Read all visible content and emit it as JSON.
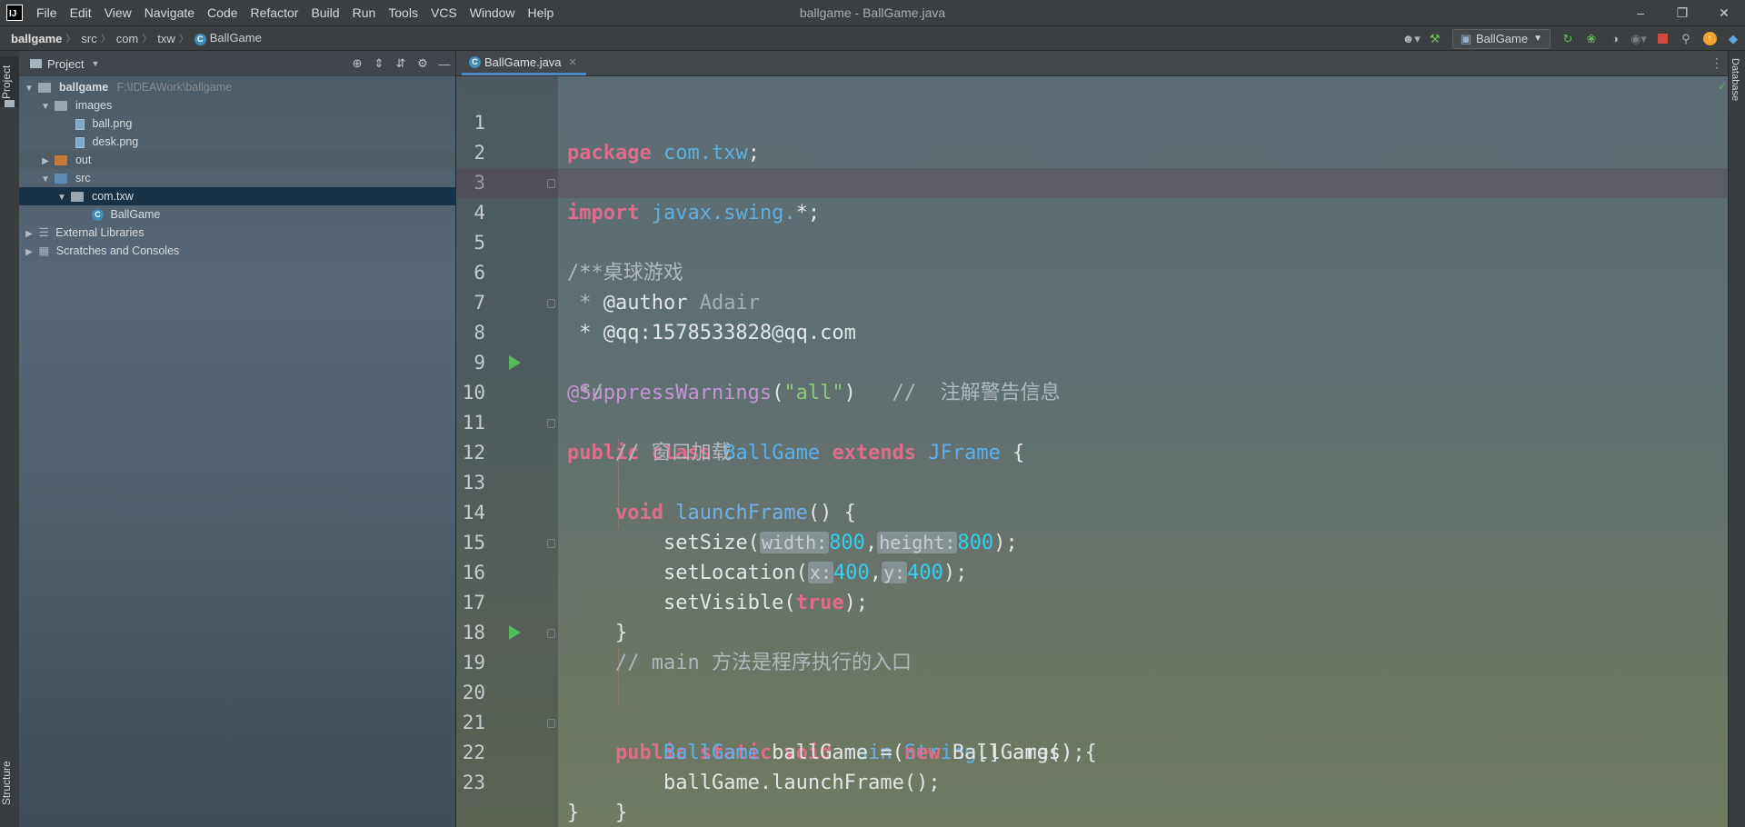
{
  "window": {
    "logo": "IJ",
    "title": "ballgame - BallGame.java",
    "menu": [
      "File",
      "Edit",
      "View",
      "Navigate",
      "Code",
      "Refactor",
      "Build",
      "Run",
      "Tools",
      "VCS",
      "Window",
      "Help"
    ],
    "controls": {
      "minimize": "–",
      "restore": "❐",
      "close": "✕"
    }
  },
  "breadcrumb": [
    "ballgame",
    "src",
    "com",
    "txw",
    "BallGame"
  ],
  "toolbar": {
    "run_config": "BallGame",
    "icons": [
      "user-icon",
      "build-hammer-icon",
      "run-config-icon",
      "rerun-icon",
      "debug-icon",
      "coverage-icon",
      "profile-icon",
      "stop-icon",
      "search-icon",
      "update-icon",
      "plugin-icon"
    ]
  },
  "sidebar": {
    "project_tab": "Project",
    "structure_tab": "Structure",
    "database_tab": "Database"
  },
  "project_panel": {
    "title": "Project",
    "tree": [
      {
        "label": "ballgame",
        "hint": "F:\\IDEAWork\\ballgame",
        "depth": 0,
        "type": "module",
        "expanded": true
      },
      {
        "label": "images",
        "depth": 1,
        "type": "folder",
        "expanded": true
      },
      {
        "label": "ball.png",
        "depth": 2,
        "type": "file"
      },
      {
        "label": "desk.png",
        "depth": 2,
        "type": "file"
      },
      {
        "label": "out",
        "depth": 1,
        "type": "folder-orange",
        "expanded": false
      },
      {
        "label": "src",
        "depth": 1,
        "type": "folder-blue",
        "expanded": true
      },
      {
        "label": "com.txw",
        "depth": 2,
        "type": "package",
        "expanded": true,
        "selected": true
      },
      {
        "label": "BallGame",
        "depth": 3,
        "type": "class"
      },
      {
        "label": "External Libraries",
        "depth": 0,
        "type": "libraries",
        "expanded": false
      },
      {
        "label": "Scratches and Consoles",
        "depth": 0,
        "type": "scratches",
        "expanded": false
      }
    ]
  },
  "editor": {
    "tab": "BallGame.java",
    "line_numbers": [
      "1",
      "2",
      "3",
      "4",
      "5",
      "6",
      "7",
      "8",
      "9",
      "10",
      "11",
      "12",
      "13",
      "14",
      "15",
      "16",
      "17",
      "18",
      "19",
      "20",
      "21",
      "22",
      "23"
    ],
    "code": {
      "l1_kw": "package",
      "l1_pkg": "com.txw",
      "l1_end": ";",
      "l3_kw": "import",
      "l3_pkg": "javax.swing.",
      "l3_end": "*;",
      "l4": "/**",
      "l5": " * 桌球游戏",
      "l6_a": " * ",
      "l6_tag": "@author",
      "l6_val": " Adair",
      "l7": " * @qq:1578533828@qq.com",
      "l8": " */",
      "l9_anno": "@SuppressWarnings",
      "l9_open": "(",
      "l9_str": "\"all\"",
      "l9_close": ")",
      "l9_cm": "   //  注解警告信息",
      "l10_kw1": "public",
      "l10_kw2": "class",
      "l10_cls": "BallGame",
      "l10_kw3": "extends",
      "l10_sup": "JFrame",
      "l10_brace": " {",
      "l11": "    // 窗口加载",
      "l12_kw": "void",
      "l12_fn": "launchFrame",
      "l12_rest": "() {",
      "l13_call": "setSize(",
      "l13_h1": "width:",
      "l13_v1": "800",
      "l13_sep": ",",
      "l13_h2": "height:",
      "l13_v2": "800",
      "l13_end": ");",
      "l14_call": "setLocation(",
      "l14_h1": "x:",
      "l14_v1": "400",
      "l14_sep": ",",
      "l14_h2": "y:",
      "l14_v2": "400",
      "l14_end": ");",
      "l15_call": "setVisible(",
      "l15_kw": "true",
      "l15_end": ");",
      "l16": "}",
      "l18": "// main 方法是程序执行的入口",
      "l19_kw1": "public",
      "l19_kw2": "static",
      "l19_kw3": "void",
      "l19_fn": "main",
      "l19_open": "(",
      "l19_cls": "String",
      "l19_rest": "[] args) {",
      "l20_cls": "BallGame",
      "l20_var": " ballGame = ",
      "l20_kw": "new",
      "l20_rest": " BallGame();",
      "l21": "ballGame.launchFrame();",
      "l22": "}",
      "l23": "}"
    }
  }
}
